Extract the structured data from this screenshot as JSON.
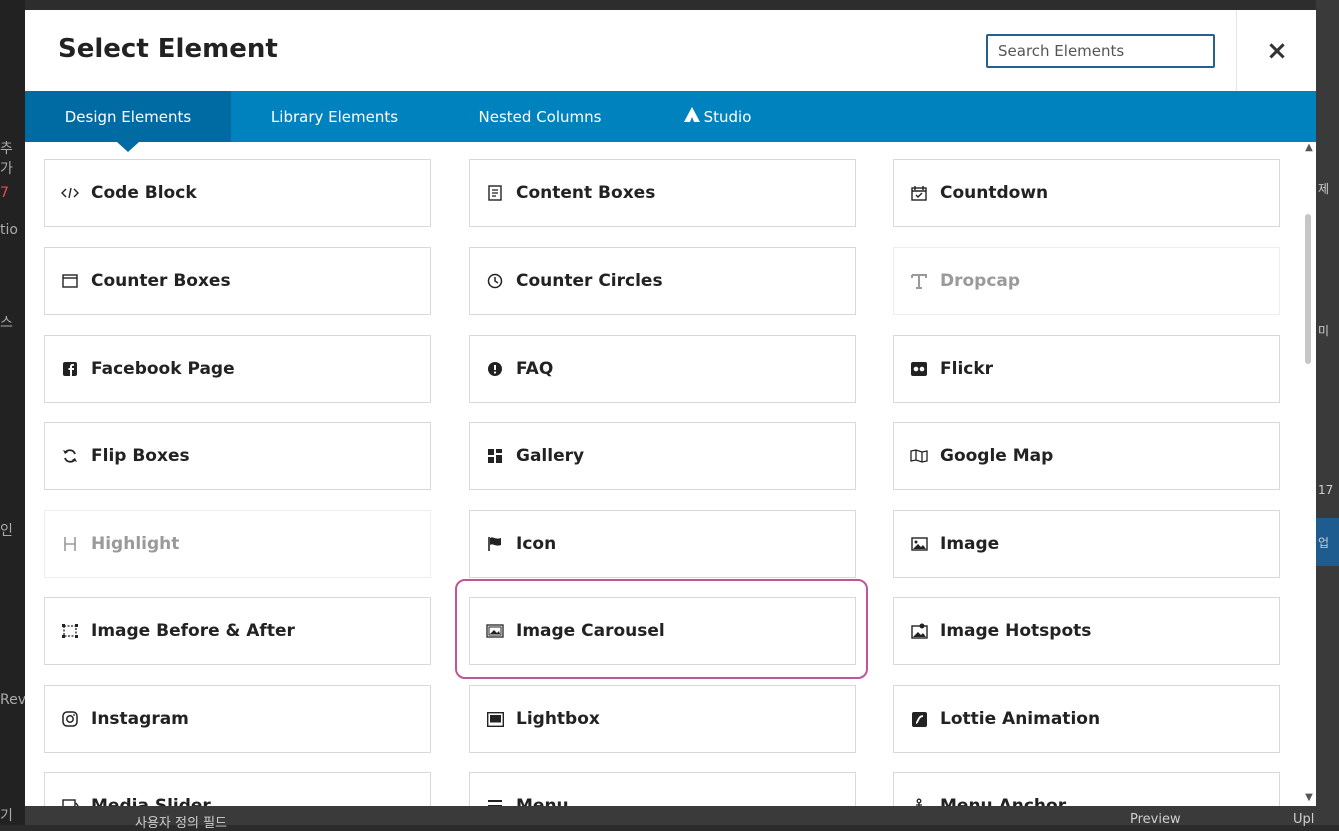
{
  "modal": {
    "title": "Select Element",
    "search_placeholder": "Search Elements",
    "close_label": "×"
  },
  "tabs": [
    {
      "label": "Design Elements",
      "active": true
    },
    {
      "label": "Library Elements",
      "active": false
    },
    {
      "label": "Nested Columns",
      "active": false
    },
    {
      "label": "Studio",
      "active": false,
      "icon": "avada-logo-icon"
    }
  ],
  "elements": [
    {
      "label": "Code Block",
      "icon": "code-icon",
      "disabled": false
    },
    {
      "label": "Content Boxes",
      "icon": "content-boxes-icon",
      "disabled": false
    },
    {
      "label": "Countdown",
      "icon": "calendar-check-icon",
      "disabled": false
    },
    {
      "label": "Counter Boxes",
      "icon": "window-icon",
      "disabled": false
    },
    {
      "label": "Counter Circles",
      "icon": "clock-icon",
      "disabled": false
    },
    {
      "label": "Dropcap",
      "icon": "text-t-icon",
      "disabled": true
    },
    {
      "label": "Facebook Page",
      "icon": "facebook-icon",
      "disabled": false
    },
    {
      "label": "FAQ",
      "icon": "exclamation-circle-icon",
      "disabled": false
    },
    {
      "label": "Flickr",
      "icon": "flickr-icon",
      "disabled": false
    },
    {
      "label": "Flip Boxes",
      "icon": "flip-arrows-icon",
      "disabled": false
    },
    {
      "label": "Gallery",
      "icon": "gallery-grid-icon",
      "disabled": false
    },
    {
      "label": "Google Map",
      "icon": "map-icon",
      "disabled": false
    },
    {
      "label": "Highlight",
      "icon": "heading-h-icon",
      "disabled": true
    },
    {
      "label": "Icon",
      "icon": "flag-icon",
      "disabled": false
    },
    {
      "label": "Image",
      "icon": "image-icon",
      "disabled": false
    },
    {
      "label": "Image Before & After",
      "icon": "before-after-icon",
      "disabled": false
    },
    {
      "label": "Image Carousel",
      "icon": "image-carousel-icon",
      "disabled": false,
      "highlighted": true
    },
    {
      "label": "Image Hotspots",
      "icon": "image-hotspots-icon",
      "disabled": false
    },
    {
      "label": "Instagram",
      "icon": "instagram-icon",
      "disabled": false
    },
    {
      "label": "Lightbox",
      "icon": "lightbox-icon",
      "disabled": false
    },
    {
      "label": "Lottie Animation",
      "icon": "lottie-icon",
      "disabled": false
    },
    {
      "label": "Media Slider",
      "icon": "media-slider-icon",
      "disabled": false
    },
    {
      "label": "Menu",
      "icon": "menu-icon",
      "disabled": false
    },
    {
      "label": "Menu Anchor",
      "icon": "anchor-icon",
      "disabled": false
    }
  ],
  "background": {
    "left_fragments": [
      "추가",
      "7",
      "tio",
      "스",
      "인",
      "Rev",
      "기"
    ],
    "right_fragments": [
      "제",
      "미",
      "17",
      "업"
    ],
    "bottom_fragments": [
      "사용자 정의 필드",
      "Preview",
      "Upl"
    ]
  }
}
